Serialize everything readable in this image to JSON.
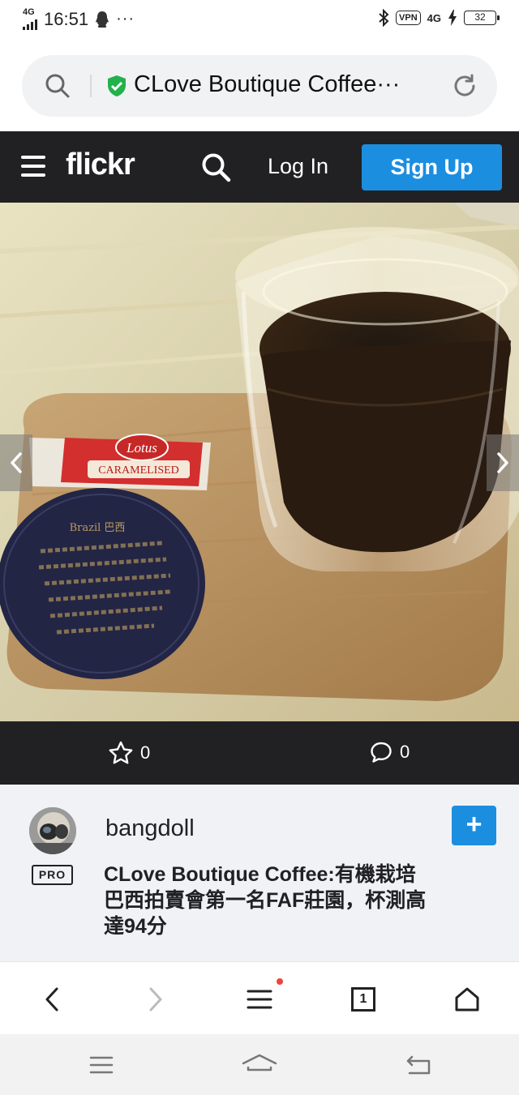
{
  "status_bar": {
    "network": "4G",
    "time": "16:51",
    "more": "···",
    "vpn": "VPN",
    "network_right": "4G",
    "battery": "32"
  },
  "url_bar": {
    "url_text": "CLove Boutique Coffee···"
  },
  "flickr_header": {
    "logo": "flickr",
    "login_label": "Log In",
    "signup_label": "Sign Up",
    "accent": "#1c8ee0"
  },
  "engagement": {
    "favorites": "0",
    "comments": "0"
  },
  "photo_info": {
    "username": "bangdoll",
    "pro_badge": "PRO",
    "add_label": "+",
    "title": "CLove Boutique Coffee:有機栽培巴西拍賣會第一名FAF莊園，杯測高達94分"
  },
  "photo_text": {
    "brand": "Lotus",
    "caramelised": "CARAMELISED",
    "card_heading": "Brazil 巴西"
  },
  "browser_toolbar": {
    "tab_count": "1"
  }
}
